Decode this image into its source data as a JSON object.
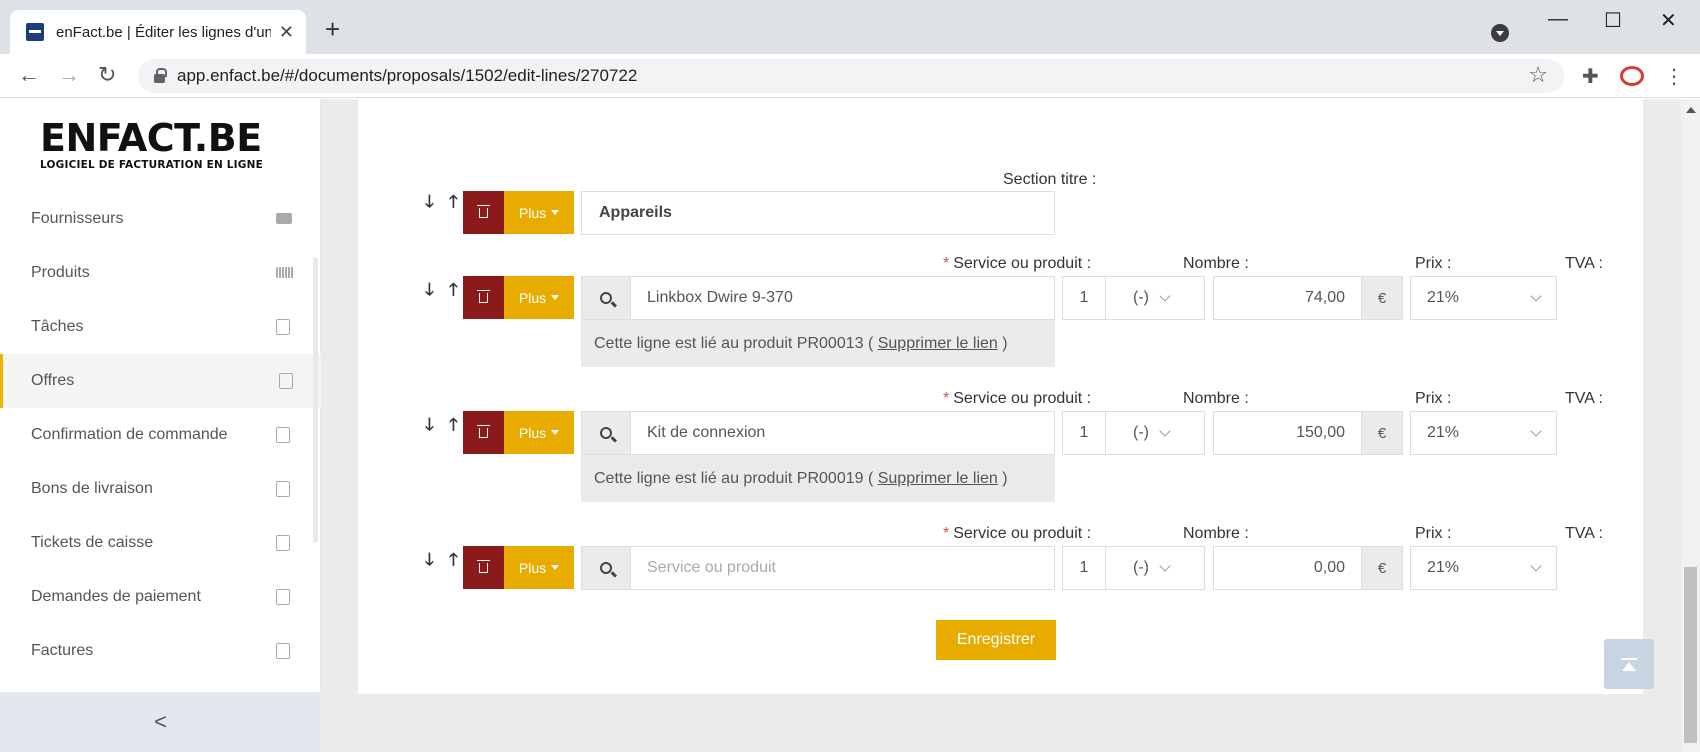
{
  "browser": {
    "tab_title": "enFact.be | Éditer les lignes d'une",
    "tab_close": "✕",
    "new_tab": "+",
    "url": "app.enfact.be/#/documents/proposals/1502/edit-lines/270722",
    "minimize": "—",
    "maximize": "☐",
    "close": "✕",
    "back": "←",
    "forward": "→",
    "reload": "↻",
    "star": "☆",
    "extensions": "✚",
    "menu": "⋮"
  },
  "logo": {
    "name": "ENFACT.BE",
    "tagline": "LOGICIEL DE FACTURATION EN LIGNE"
  },
  "sidebar": {
    "items": [
      {
        "label": "Fournisseurs",
        "icon": "truck-icon"
      },
      {
        "label": "Produits",
        "icon": "barcode-icon"
      },
      {
        "label": "Tâches",
        "icon": "calendar-check-icon"
      },
      {
        "label": "Offres",
        "icon": "pdf-file-icon",
        "active": true
      },
      {
        "label": "Confirmation de commande",
        "icon": "pdf-file-icon"
      },
      {
        "label": "Bons de livraison",
        "icon": "pdf-file-icon"
      },
      {
        "label": "Tickets de caisse",
        "icon": "pdf-file-icon"
      },
      {
        "label": "Demandes de paiement",
        "icon": "pdf-file-icon"
      },
      {
        "label": "Factures",
        "icon": "pdf-file-icon"
      }
    ],
    "collapse": "<"
  },
  "labels": {
    "section_title": "Section titre :",
    "service": "Service ou produit :",
    "nombre": "Nombre :",
    "prix": "Prix :",
    "tva": "TVA :",
    "required": "*"
  },
  "buttons": {
    "plus": "Plus",
    "save": "Enregistrer",
    "down": "🡓",
    "up": "🡑"
  },
  "section": {
    "title_value": "Appareils"
  },
  "lines": [
    {
      "product": "Linkbox Dwire 9-370",
      "quantity": "1",
      "unit": "(-)",
      "price": "74,00",
      "currency": "€",
      "vat": "21%",
      "link_prefix": "Cette ligne est lié au produit PR00013 (",
      "link_text": "Supprimer le lien",
      "link_suffix": ")"
    },
    {
      "product": "Kit de connexion",
      "quantity": "1",
      "unit": "(-)",
      "price": "150,00",
      "currency": "€",
      "vat": "21%",
      "link_prefix": "Cette ligne est lié au produit PR00019 (",
      "link_text": "Supprimer le lien",
      "link_suffix": ")"
    },
    {
      "product_placeholder": "Service ou produit",
      "quantity": "1",
      "unit": "(-)",
      "price": "0,00",
      "currency": "€",
      "vat": "21%"
    }
  ]
}
